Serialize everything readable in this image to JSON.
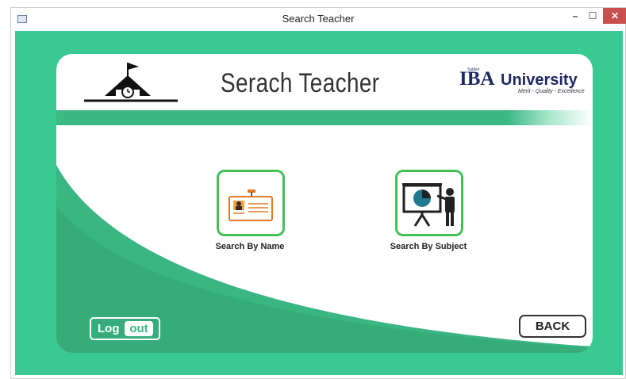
{
  "window": {
    "title": "Search Teacher",
    "minimize_glyph": "–",
    "maximize_glyph": "☐",
    "close_glyph": "✕"
  },
  "header": {
    "title": "Serach Teacher",
    "logo": {
      "brand": "IBA",
      "name": "University",
      "sukkur": "Sukkur",
      "tagline": "Merit - Quality - Excellence"
    }
  },
  "actions": {
    "search_by_name": "Search By Name",
    "search_by_subject": "Search By Subject"
  },
  "footer": {
    "logout_log": "Log",
    "logout_out": "out",
    "back": "BACK"
  },
  "colors": {
    "frame_green": "#3ac992",
    "strip_green": "#3bb884",
    "tile_border": "#44c156",
    "logo_navy": "#1f2a63"
  }
}
